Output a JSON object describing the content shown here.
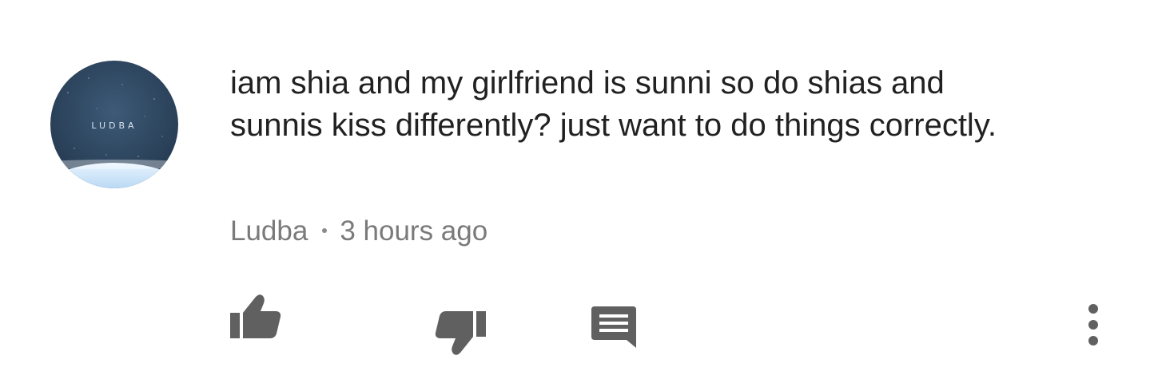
{
  "comment": {
    "text": "iam shia and my girlfriend is sunni so do shias and sunnis kiss differently? just want to do things correctly.",
    "author": "Ludba",
    "timestamp": "3 hours ago",
    "avatar_text": "LUDBA"
  },
  "actions": {
    "like_icon": "thumbs-up-icon",
    "dislike_icon": "thumbs-down-icon",
    "reply_icon": "comment-icon",
    "more_icon": "more-vertical-icon"
  },
  "colors": {
    "text": "#212121",
    "meta": "#7a7a7a",
    "icon": "#606060"
  }
}
